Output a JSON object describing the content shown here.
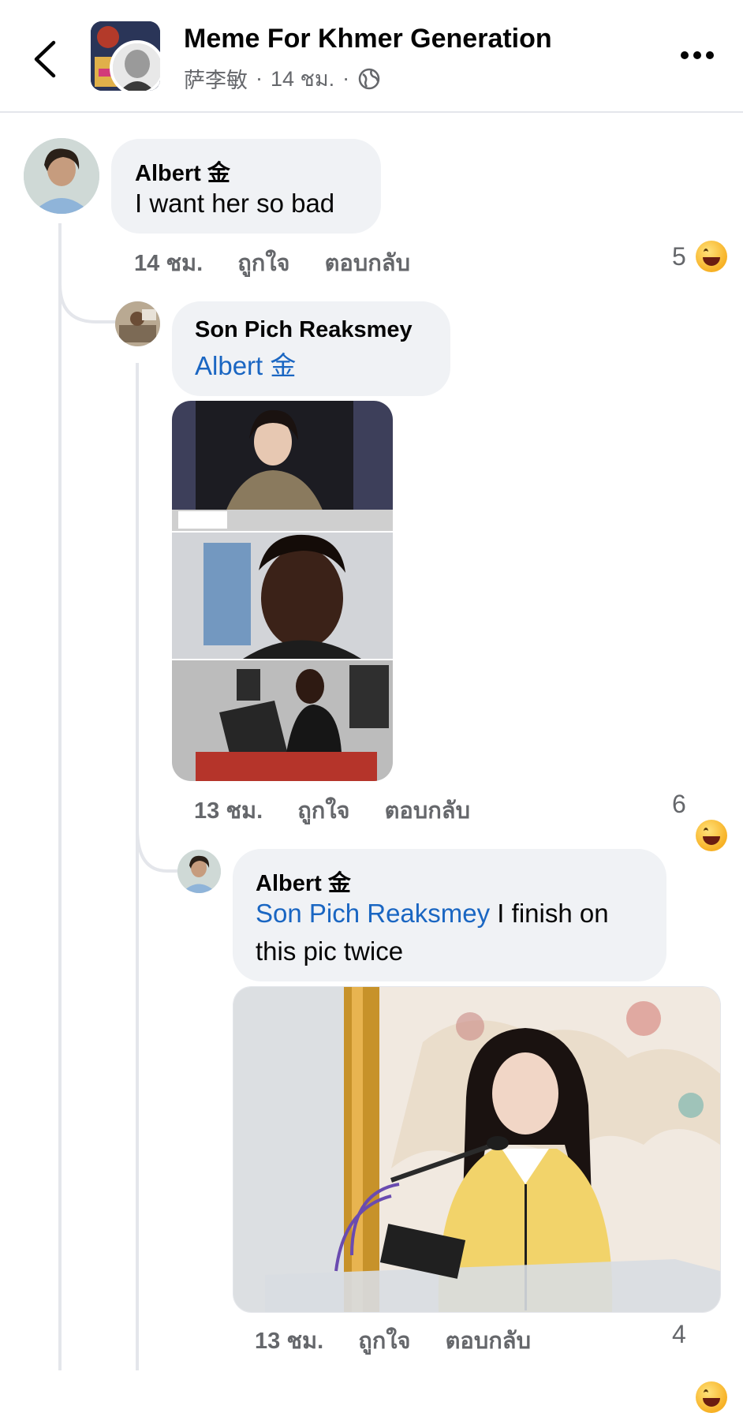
{
  "header": {
    "group_name": "Meme For Khmer Generation",
    "poster": "萨李敏",
    "separator": "·",
    "time": "14 ชม.",
    "separator2": "·"
  },
  "comments": [
    {
      "author": "Albert 金",
      "text": "I want her so bad",
      "time": "14 ชม.",
      "like_label": "ถูกใจ",
      "reply_label": "ตอบกลับ",
      "reaction_count": "5",
      "reaction_icon": "haha-icon"
    },
    {
      "author": "Son Pich Reaksmey",
      "mention": "Albert 金",
      "time": "13 ชม.",
      "like_label": "ถูกใจ",
      "reply_label": "ตอบกลับ",
      "reaction_count": "6",
      "reaction_icon": "haha-icon"
    },
    {
      "author": "Albert 金",
      "mention": "Son Pich Reaksmey",
      "text_after_mention": " I finish on",
      "text_line2": "this pic twice",
      "time": "13 ชม.",
      "like_label": "ถูกใจ",
      "reply_label": "ตอบกลับ",
      "reaction_count": "4",
      "reaction_icon": "haha-icon"
    }
  ]
}
